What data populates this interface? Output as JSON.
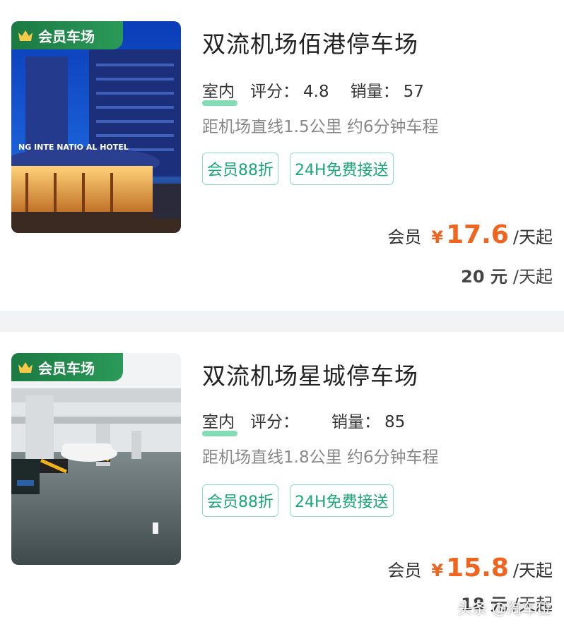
{
  "listings": [
    {
      "badge": "会员车场",
      "title": "双流机场佰港停车场",
      "indoor": "室内",
      "rating_label": "评分：",
      "rating": "4.8",
      "sales_label": "销量：",
      "sales": "57",
      "distance": "距机场直线1.5公里 约6分钟车程",
      "tags": [
        "会员88折",
        "24H免费接送"
      ],
      "member_label": "会员",
      "currency": "¥",
      "member_price": "17.6",
      "unit": "/天起",
      "original_price": "20 元",
      "original_unit": "/天起"
    },
    {
      "badge": "会员车场",
      "title": "双流机场星城停车场",
      "indoor": "室内",
      "rating_label": "评分：",
      "rating": "",
      "sales_label": "销量：",
      "sales": "85",
      "distance": "距机场直线1.8公里 约6分钟车程",
      "tags": [
        "会员88折",
        "24H免费接送"
      ],
      "member_label": "会员",
      "currency": "¥",
      "member_price": "15.8",
      "unit": "/天起",
      "original_price": "18 元",
      "original_unit": "/天起"
    }
  ],
  "watermark": "头条 @淘车位",
  "colors": {
    "accent_price": "#f0641e",
    "tag_green": "#1aa879",
    "badge_green": "#1c7a43"
  }
}
